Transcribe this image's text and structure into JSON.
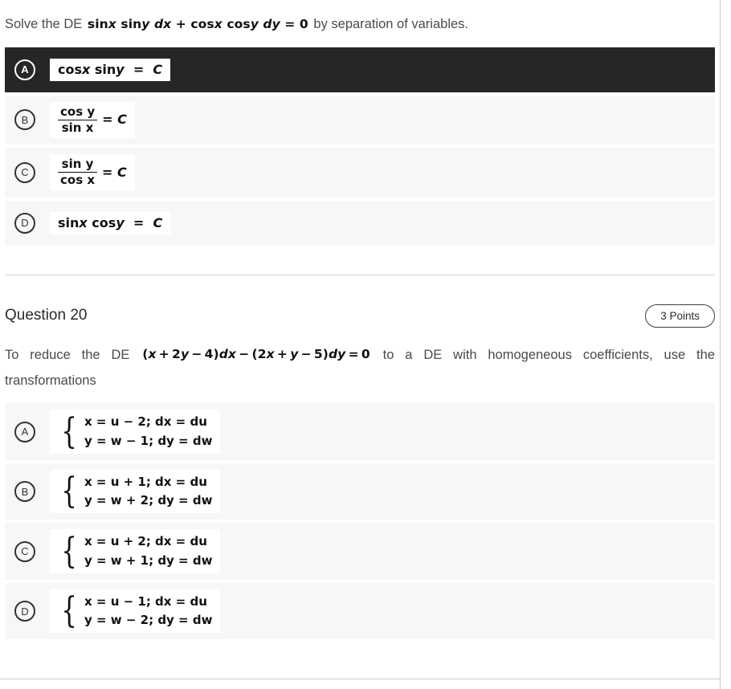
{
  "questions": [
    {
      "stem_prefix": "Solve the DE",
      "stem_formula": "sinx siny dx + cosx cosy dy = 0",
      "stem_suffix": "by separation of variables.",
      "choices": [
        {
          "letter": "A",
          "text": "cosx siny = C",
          "selected": true
        },
        {
          "letter": "B",
          "numerator": "cos y",
          "denominator": "sin x",
          "rhs": "= C",
          "selected": false
        },
        {
          "letter": "C",
          "numerator": "sin y",
          "denominator": "cos x",
          "rhs": "= C",
          "selected": false
        },
        {
          "letter": "D",
          "text": "sinx cosy = C",
          "selected": false
        }
      ]
    },
    {
      "title": "Question 20",
      "points_badge": "3 Points",
      "stem_prefix": "To reduce the DE",
      "stem_formula": "(x+2y-4)dx-(2x+y-5)dy=0",
      "stem_suffix": "to a DE with homogeneous coefficients, use the transformations",
      "choices": [
        {
          "letter": "A",
          "line1": "x = u − 2;  dx = du",
          "line2": "y = w − 1;  dy = dw",
          "selected": false
        },
        {
          "letter": "B",
          "line1": "x = u + 1;  dx = du",
          "line2": "y = w + 2;  dy = dw",
          "selected": false
        },
        {
          "letter": "C",
          "line1": "x = u + 2;  dx = du",
          "line2": "y = w + 1;  dy = dw",
          "selected": false
        },
        {
          "letter": "D",
          "line1": "x = u − 1;  dx = du",
          "line2": "y = w − 2;  dy = dw",
          "selected": false
        }
      ]
    }
  ],
  "colors": {
    "selected_background": "#262626",
    "row_background": "#f7f7f7",
    "text": "#4a4a4a",
    "rule": "#d4d4d4"
  }
}
